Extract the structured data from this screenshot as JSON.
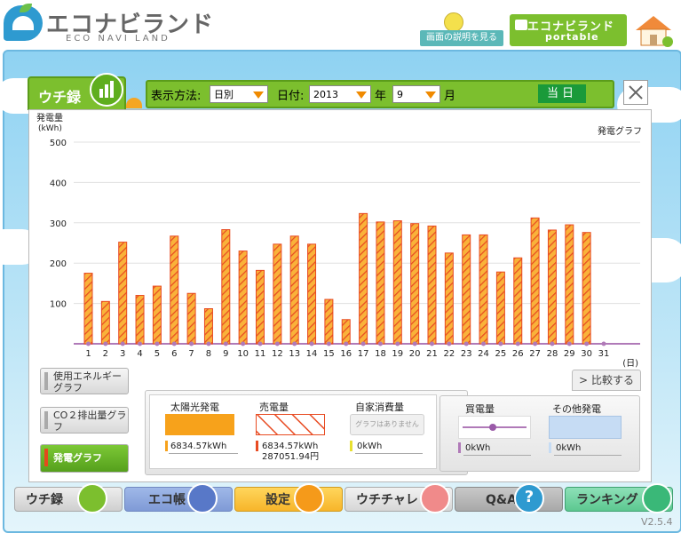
{
  "header": {
    "logo_text": "エコナビランド",
    "logo_sub": "ECO NAVI LAND",
    "help_label": "画面の説明を見る",
    "portable_title": "エコナビランド",
    "portable_sub": "portable"
  },
  "tab": {
    "label": "ウチ録"
  },
  "toolbar": {
    "mode_label": "表示方法:",
    "mode_value": "日別",
    "date_label": "日付:",
    "year_value": "2013",
    "year_unit": "年",
    "month_value": "9",
    "month_unit": "月",
    "today_label": "当日"
  },
  "side_buttons": {
    "energy": "使用エネルギーグラフ",
    "co2": "CO２排出量グラフ",
    "power": "発電グラフ"
  },
  "compare_label": "比較する",
  "legend": {
    "solar_title": "太陽光発電",
    "solar_value": "6834.57kWh",
    "sold_title": "売電量",
    "sold_value": "6834.57kWh",
    "sold_yen": "287051.94円",
    "self_title": "自家消費量",
    "self_note": "グラフはありません",
    "self_value": "0kWh",
    "bought_title": "買電量",
    "bought_value": "0kWh",
    "other_title": "その他発電",
    "other_value": "0kWh"
  },
  "nav": {
    "uchiroku": "ウチ録",
    "ecocho": "エコ帳",
    "settings": "設定",
    "uchichare": "ウチチャレ",
    "qa": "Q&A",
    "ranking": "ランキング"
  },
  "version": "V2.5.4",
  "colors": {
    "solar_fill": "#f7a21b",
    "sold_stroke": "#e84b22",
    "bought_line": "#b07ab8",
    "other_fill": "#c6dcf4"
  },
  "chart_data": {
    "type": "bar",
    "title": "発電グラフ",
    "ylabel": "発電量 (kWh)",
    "xlabel": "(日)",
    "ylim": [
      0,
      500
    ],
    "yticks": [
      100,
      200,
      300,
      400,
      500
    ],
    "categories": [
      "1",
      "2",
      "3",
      "4",
      "5",
      "6",
      "7",
      "8",
      "9",
      "10",
      "11",
      "12",
      "13",
      "14",
      "15",
      "16",
      "17",
      "18",
      "19",
      "20",
      "21",
      "22",
      "23",
      "24",
      "25",
      "26",
      "27",
      "28",
      "29",
      "30",
      "31"
    ],
    "series": [
      {
        "name": "売電量",
        "values": [
          175,
          105,
          252,
          120,
          143,
          267,
          125,
          87,
          283,
          230,
          182,
          247,
          267,
          247,
          110,
          60,
          323,
          302,
          305,
          298,
          292,
          225,
          270,
          270,
          178,
          213,
          312,
          282,
          295,
          276,
          0
        ]
      }
    ],
    "grid": true
  }
}
